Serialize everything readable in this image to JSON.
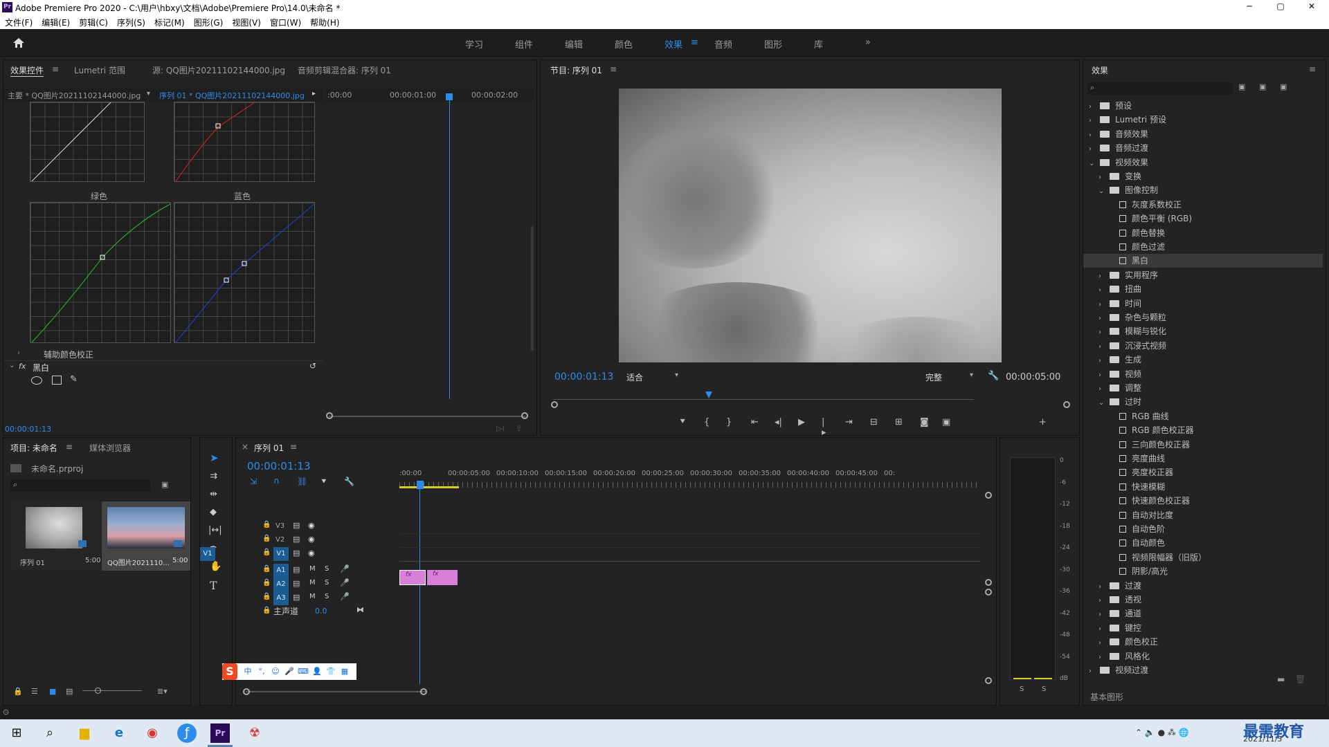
{
  "app": {
    "title": "Adobe Premiere Pro 2020 - C:\\用户\\hbxy\\文档\\Adobe\\Premiere Pro\\14.0\\未命名 *",
    "logo": "Pr"
  },
  "window_controls": {
    "minimize": "─",
    "maximize": "▢",
    "close": "✕"
  },
  "menu": [
    "文件(F)",
    "编辑(E)",
    "剪辑(C)",
    "序列(S)",
    "标记(M)",
    "图形(G)",
    "视图(V)",
    "窗口(W)",
    "帮助(H)"
  ],
  "workspaces": {
    "home_icon": "home-icon",
    "tabs": [
      "学习",
      "组件",
      "编辑",
      "颜色",
      "效果",
      "音频",
      "图形",
      "库"
    ],
    "active": "效果",
    "more": "»"
  },
  "effect_controls": {
    "tabs": [
      "效果控件",
      "Lumetri 范围",
      "源: QQ图片20211102144000.jpg",
      "音频剪辑混合器: 序列 01"
    ],
    "menu_icon": "≡",
    "master_clip": "主要 * QQ图片20211102144000.jpg",
    "seq_clip": "序列 01 * QQ图片20211102144000.jpg",
    "ruler": [
      ":00:00",
      "00:00:01:00",
      "00:00:02:00"
    ],
    "curve_labels": {
      "green": "绿色",
      "blue": "蓝色"
    },
    "secondary": "辅助颜色校正",
    "fx_label": "fx",
    "effect_name": "黑白",
    "timecode": "00:00:01:13"
  },
  "program_monitor": {
    "title": "节目: 序列 01",
    "timecode": "00:00:01:13",
    "fit": "适合",
    "quality": "完整",
    "duration": "00:00:05:00"
  },
  "effects_panel": {
    "title": "效果",
    "search_placeholder": "",
    "items": [
      {
        "label": "预设",
        "level": 0,
        "type": "folder",
        "open": false
      },
      {
        "label": "Lumetri 预设",
        "level": 0,
        "type": "folder",
        "open": false
      },
      {
        "label": "音频效果",
        "level": 0,
        "type": "folder",
        "open": false
      },
      {
        "label": "音频过渡",
        "level": 0,
        "type": "folder",
        "open": false
      },
      {
        "label": "视频效果",
        "level": 0,
        "type": "folder",
        "open": true
      },
      {
        "label": "变换",
        "level": 1,
        "type": "folder",
        "open": false
      },
      {
        "label": "图像控制",
        "level": 1,
        "type": "folder",
        "open": true
      },
      {
        "label": "灰度系数校正",
        "level": 2,
        "type": "fx"
      },
      {
        "label": "颜色平衡 (RGB)",
        "level": 2,
        "type": "fx"
      },
      {
        "label": "颜色替换",
        "level": 2,
        "type": "fx"
      },
      {
        "label": "颜色过滤",
        "level": 2,
        "type": "fx"
      },
      {
        "label": "黑白",
        "level": 2,
        "type": "fx",
        "selected": true
      },
      {
        "label": "实用程序",
        "level": 1,
        "type": "folder",
        "open": false
      },
      {
        "label": "扭曲",
        "level": 1,
        "type": "folder",
        "open": false
      },
      {
        "label": "时间",
        "level": 1,
        "type": "folder",
        "open": false
      },
      {
        "label": "杂色与颗粒",
        "level": 1,
        "type": "folder",
        "open": false
      },
      {
        "label": "模糊与锐化",
        "level": 1,
        "type": "folder",
        "open": false
      },
      {
        "label": "沉浸式视频",
        "level": 1,
        "type": "folder",
        "open": false
      },
      {
        "label": "生成",
        "level": 1,
        "type": "folder",
        "open": false
      },
      {
        "label": "视频",
        "level": 1,
        "type": "folder",
        "open": false
      },
      {
        "label": "调整",
        "level": 1,
        "type": "folder",
        "open": false
      },
      {
        "label": "过时",
        "level": 1,
        "type": "folder",
        "open": true
      },
      {
        "label": "RGB 曲线",
        "level": 2,
        "type": "fx"
      },
      {
        "label": "RGB 颜色校正器",
        "level": 2,
        "type": "fx"
      },
      {
        "label": "三向颜色校正器",
        "level": 2,
        "type": "fx"
      },
      {
        "label": "亮度曲线",
        "level": 2,
        "type": "fx"
      },
      {
        "label": "亮度校正器",
        "level": 2,
        "type": "fx"
      },
      {
        "label": "快速模糊",
        "level": 2,
        "type": "fx"
      },
      {
        "label": "快速颜色校正器",
        "level": 2,
        "type": "fx"
      },
      {
        "label": "自动对比度",
        "level": 2,
        "type": "fx"
      },
      {
        "label": "自动色阶",
        "level": 2,
        "type": "fx"
      },
      {
        "label": "自动颜色",
        "level": 2,
        "type": "fx"
      },
      {
        "label": "视频限幅器（旧版）",
        "level": 2,
        "type": "fx"
      },
      {
        "label": "阴影/高光",
        "level": 2,
        "type": "fx"
      },
      {
        "label": "过渡",
        "level": 1,
        "type": "folder",
        "open": false
      },
      {
        "label": "透视",
        "level": 1,
        "type": "folder",
        "open": false
      },
      {
        "label": "通道",
        "level": 1,
        "type": "folder",
        "open": false
      },
      {
        "label": "键控",
        "level": 1,
        "type": "folder",
        "open": false
      },
      {
        "label": "颜色校正",
        "level": 1,
        "type": "folder",
        "open": false
      },
      {
        "label": "风格化",
        "level": 1,
        "type": "folder",
        "open": false
      },
      {
        "label": "视频过渡",
        "level": 0,
        "type": "folder",
        "open": false
      }
    ],
    "basic_graphics": "基本图形"
  },
  "project": {
    "tabs": [
      "项目: 未命名",
      "媒体浏览器"
    ],
    "file": "未命名.prproj",
    "items": [
      {
        "name": "序列 01",
        "duration": "5:00"
      },
      {
        "name": "QQ图片2021110...",
        "duration": "5:00"
      }
    ]
  },
  "timeline": {
    "title": "序列 01",
    "timecode": "00:00:01:13",
    "ruler": [
      ":00:00",
      "00:00:05:00",
      "00:00:10:00",
      "00:00:15:00",
      "00:00:20:00",
      "00:00:25:00",
      "00:00:30:00",
      "00:00:35:00",
      "00:00:40:00",
      "00:00:45:00",
      "00:"
    ],
    "video_tracks": [
      "V3",
      "V2",
      "V1"
    ],
    "audio_tracks": [
      "A1",
      "A2",
      "A3"
    ],
    "source_patch_v": "V1",
    "master": "主声道",
    "master_val": "0.0",
    "mute": "M",
    "solo": "S",
    "clip_label": "fx"
  },
  "audio_meter": {
    "scale": [
      "0",
      "-6",
      "-12",
      "-18",
      "-24",
      "-30",
      "-36",
      "-42",
      "-48",
      "-54",
      "dB"
    ],
    "solo": [
      "S",
      "S"
    ]
  },
  "ime": {
    "items": [
      "中",
      "°,",
      "☺",
      "🎤",
      "⌨",
      "👤",
      "👕",
      "▦"
    ]
  },
  "taskbar": {
    "date": "2021/11/5",
    "watermark": "最需教育"
  }
}
